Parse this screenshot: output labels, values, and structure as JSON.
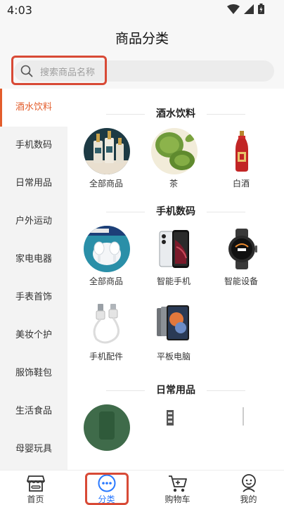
{
  "status": {
    "time": "4:03"
  },
  "header": {
    "title": "商品分类"
  },
  "search": {
    "placeholder": "搜索商品名称"
  },
  "sidebar": {
    "items": [
      {
        "label": "酒水饮料",
        "active": true
      },
      {
        "label": "手机数码"
      },
      {
        "label": "日常用品"
      },
      {
        "label": "户外运动"
      },
      {
        "label": "家电电器"
      },
      {
        "label": "手表首饰"
      },
      {
        "label": "美妆个护"
      },
      {
        "label": "服饰鞋包"
      },
      {
        "label": "生活食品"
      },
      {
        "label": "母婴玩具"
      }
    ]
  },
  "sections": [
    {
      "title": "酒水饮料",
      "items": [
        {
          "label": "全部商品",
          "icon": "liquor-bottles-image"
        },
        {
          "label": "茶",
          "icon": "tea-leaves-image"
        },
        {
          "label": "白酒",
          "icon": "baijiu-bottle-image"
        }
      ]
    },
    {
      "title": "手机数码",
      "items": [
        {
          "label": "全部商品",
          "icon": "earbuds-image"
        },
        {
          "label": "智能手机",
          "icon": "smartphone-image"
        },
        {
          "label": "智能设备",
          "icon": "smartwatch-image"
        },
        {
          "label": "手机配件",
          "icon": "usb-cable-image"
        },
        {
          "label": "平板电脑",
          "icon": "tablet-image"
        }
      ]
    },
    {
      "title": "日常用品",
      "items": []
    }
  ],
  "nav": {
    "items": [
      {
        "label": "首页",
        "icon": "store-icon"
      },
      {
        "label": "分类",
        "icon": "category-dots-icon",
        "active": true
      },
      {
        "label": "购物车",
        "icon": "cart-icon"
      },
      {
        "label": "我的",
        "icon": "profile-icon"
      }
    ]
  },
  "colors": {
    "accent": "#e35d2c",
    "nav_active": "#2979ff",
    "highlight": "#d84a36"
  }
}
